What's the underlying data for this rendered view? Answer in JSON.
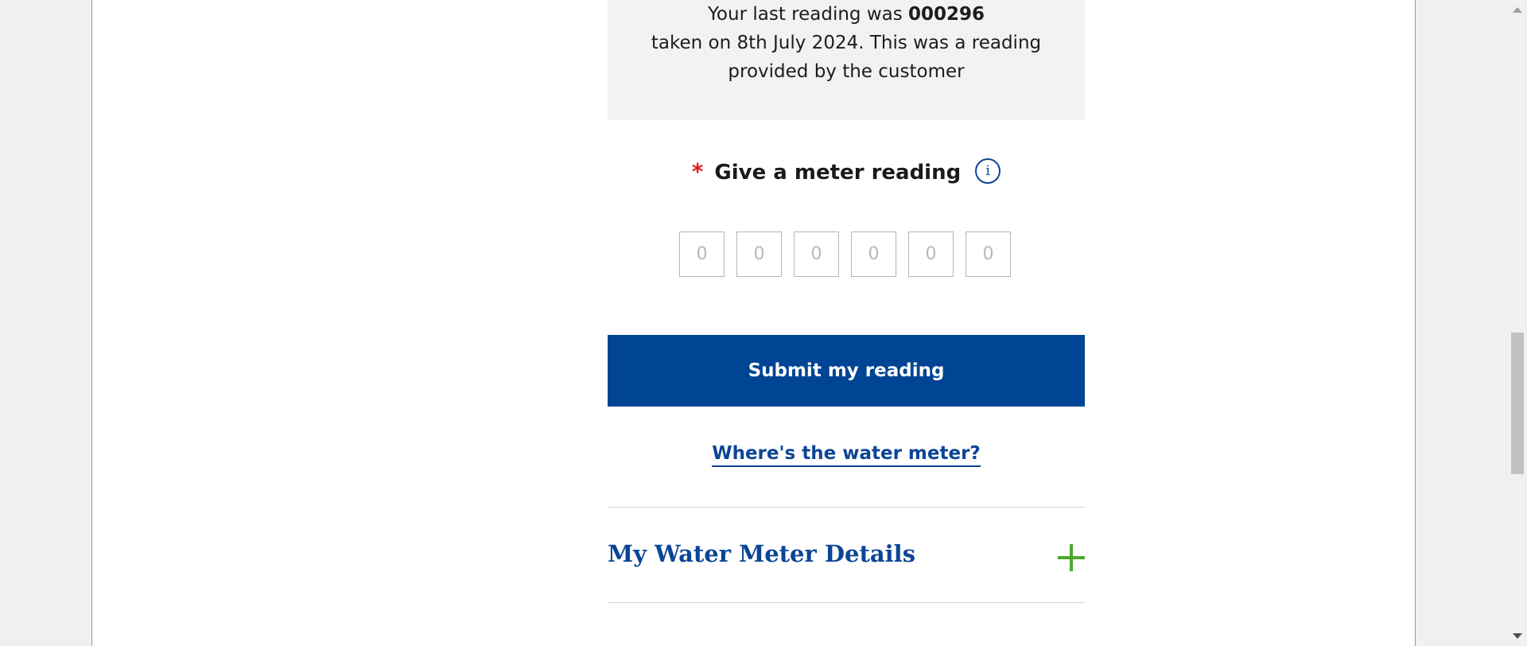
{
  "last_reading": {
    "prefix": "Your last reading was ",
    "value": "000296",
    "line2": "taken on 8th July 2024. This was a reading",
    "line3": "provided by the customer"
  },
  "meter_reading": {
    "required_marker": "*",
    "label": "Give a meter reading",
    "info_icon": "info-icon",
    "info_glyph": "i",
    "digit_placeholders": [
      "0",
      "0",
      "0",
      "0",
      "0",
      "0"
    ]
  },
  "submit": {
    "label": "Submit my reading"
  },
  "help_link": {
    "label": "Where's the water meter?"
  },
  "accordion": {
    "title": "My Water Meter Details",
    "icon": "plus-icon"
  },
  "colors": {
    "primary": "#004494",
    "link": "#0b4596",
    "required": "#e0191b",
    "accent_green": "#4fa82d",
    "panel_bg": "#f2f2f2"
  }
}
